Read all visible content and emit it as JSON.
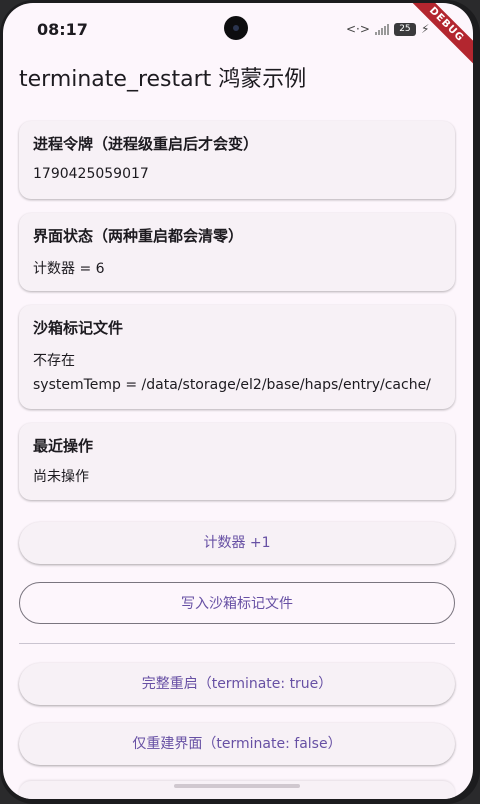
{
  "status_bar": {
    "time": "08:17",
    "battery": "25",
    "debug_label": "DEBUG"
  },
  "app": {
    "title": "terminate_restart 鸿蒙示例"
  },
  "cards": {
    "process_token": {
      "title": "进程令牌（进程级重启后才会变）",
      "value": "1790425059017"
    },
    "ui_state": {
      "title": "界面状态（两种重启都会清零）",
      "value": "计数器 = 6"
    },
    "sandbox_file": {
      "title": "沙箱标记文件",
      "status": "不存在",
      "path": "systemTemp = /data/storage/el2/base/haps/entry/cache/"
    },
    "recent_action": {
      "title": "最近操作",
      "value": "尚未操作"
    }
  },
  "buttons": {
    "increment": "计数器 +1",
    "write_file": "写入沙箱标记文件",
    "full_restart": "完整重启（terminate: true）",
    "rebuild_ui": "仅重建界面（terminate: false）"
  },
  "colors": {
    "background": "#fdf6fc",
    "card": "#f7f1f6",
    "accent": "#6750a4",
    "debug_ribbon": "#b3262f"
  },
  "icons": [
    "camera-icon",
    "nfc-icon",
    "signal-icon",
    "battery-icon",
    "charging-icon"
  ]
}
